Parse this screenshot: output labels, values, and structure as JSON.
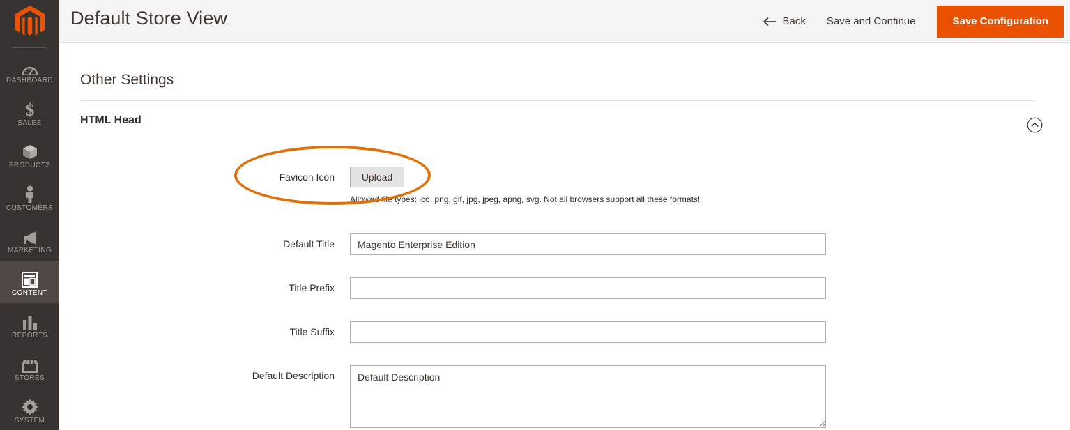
{
  "sidebar": {
    "logo": "magento-logo",
    "items": [
      {
        "label": "DASHBOARD",
        "icon": "dashboard-icon",
        "active": false
      },
      {
        "label": "SALES",
        "icon": "sales-icon",
        "active": false
      },
      {
        "label": "PRODUCTS",
        "icon": "products-icon",
        "active": false
      },
      {
        "label": "CUSTOMERS",
        "icon": "customers-icon",
        "active": false
      },
      {
        "label": "MARKETING",
        "icon": "marketing-icon",
        "active": false
      },
      {
        "label": "CONTENT",
        "icon": "content-icon",
        "active": true
      },
      {
        "label": "REPORTS",
        "icon": "reports-icon",
        "active": false
      },
      {
        "label": "STORES",
        "icon": "stores-icon",
        "active": false
      },
      {
        "label": "SYSTEM",
        "icon": "system-icon",
        "active": false
      }
    ]
  },
  "header": {
    "title": "Default Store View",
    "back_label": "Back",
    "save_continue_label": "Save and Continue",
    "save_config_label": "Save Configuration",
    "accent_color": "#eb5202",
    "background_color": "#f5f5f5"
  },
  "main": {
    "section_title": "Other Settings",
    "group_title": "HTML Head",
    "collapse_icon": "chevron-up-circle-icon",
    "fields": [
      {
        "label": "Favicon Icon",
        "type": "upload",
        "button_label": "Upload",
        "note": "Allowed file types: ico, png, gif, jpg, jpeg, apng, svg. Not all browsers support all these formats!"
      },
      {
        "label": "Default Title",
        "type": "text",
        "value": "Magento Enterprise Edition",
        "placeholder": ""
      },
      {
        "label": "Title Prefix",
        "type": "text",
        "value": "",
        "placeholder": ""
      },
      {
        "label": "Title Suffix",
        "type": "text",
        "value": "",
        "placeholder": ""
      },
      {
        "label": "Default Description",
        "type": "textarea",
        "value": "Default Description",
        "placeholder": ""
      }
    ]
  },
  "annotation": {
    "shape": "ellipse",
    "color": "#e0710a",
    "target": "favicon-icon-field"
  }
}
